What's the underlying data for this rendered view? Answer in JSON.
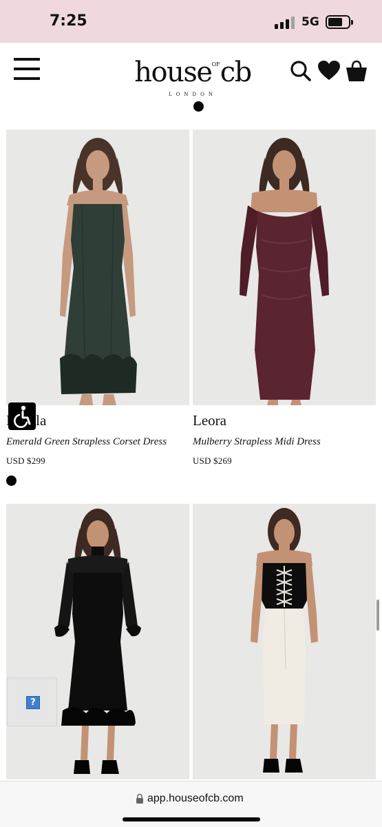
{
  "status_bar": {
    "time": "7:25",
    "network": "5G"
  },
  "header": {
    "logo_text": "house",
    "logo_superscript": "OF",
    "logo_suffix": "cb",
    "logo_subtitle": "LONDON",
    "icons": [
      "menu-icon",
      "search-icon",
      "heart-icon",
      "shopping-bag-icon"
    ]
  },
  "products": [
    {
      "name": "Lucula",
      "description": "Emerald Green Strapless Corset Dress",
      "price": "USD $299",
      "dress_color": "#2f3e37"
    },
    {
      "name": "Leora",
      "description": "Mulberry Strapless Midi Dress",
      "price": "USD $269",
      "dress_color": "#5a2530"
    },
    {
      "dress_color": "#0d0d0d"
    },
    {
      "dress_color": "#f0ece3"
    }
  ],
  "browser": {
    "url": "app.houseofcb.com"
  },
  "accessibility": {
    "help_label": "?"
  },
  "colors": {
    "status_bar_bg": "#efd9de",
    "image_bg": "#e7e7e5",
    "help_blue": "#3f7fd0"
  }
}
